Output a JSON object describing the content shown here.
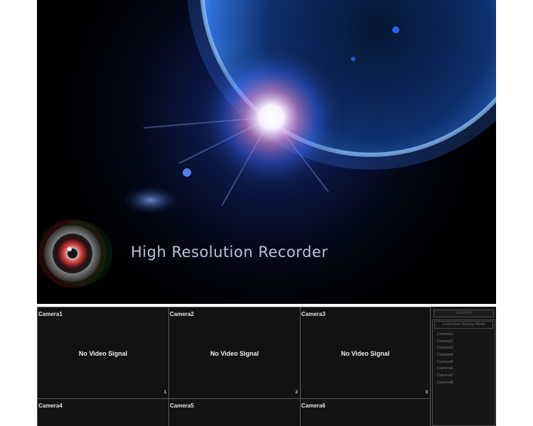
{
  "splash": {
    "title": "High Resolution Recorder"
  },
  "cameras": [
    {
      "name": "Camera1",
      "signal": "No Video Signal",
      "number": "1"
    },
    {
      "name": "Camera2",
      "signal": "No Video Signal",
      "number": "2"
    },
    {
      "name": "Camera3",
      "signal": "No Video Signal",
      "number": "3"
    },
    {
      "name": "Camera4",
      "signal": "",
      "number": ""
    },
    {
      "name": "Camera5",
      "signal": "",
      "number": ""
    },
    {
      "name": "Camera6",
      "signal": "",
      "number": ""
    }
  ],
  "side_panel": {
    "header": "Camera",
    "title": "Customize Display Mode",
    "items": [
      "Camera1",
      "Camera2",
      "Camera3",
      "Camera4",
      "Camera5",
      "Camera6",
      "Camera7",
      "Camera8"
    ]
  },
  "colors": {
    "planet_glow": "#3f7fff",
    "background": "#000000",
    "grid_line": "#5a5a5a"
  }
}
